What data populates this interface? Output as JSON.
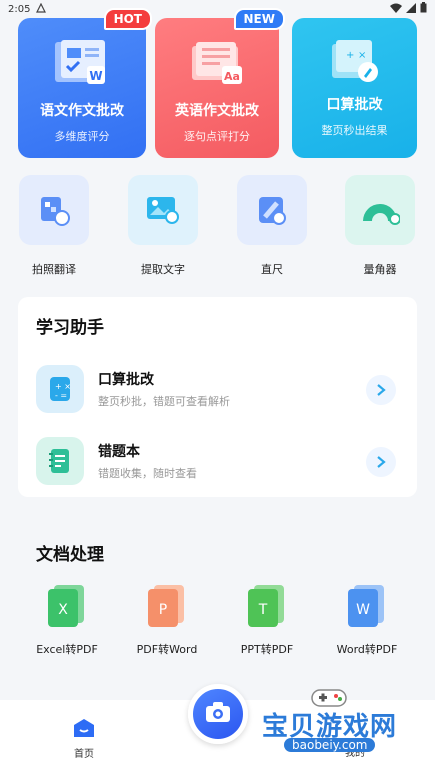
{
  "status_bar": {
    "time": "2:05"
  },
  "feature_cards": [
    {
      "title": "语文作文批改",
      "subtitle": "多维度评分",
      "tag": "HOT",
      "icon": "document-w-icon"
    },
    {
      "title": "英语作文批改",
      "subtitle": "逐句点评打分",
      "tag": "NEW",
      "icon": "newspaper-aa-icon"
    },
    {
      "title": "口算批改",
      "subtitle": "整页秒出结果",
      "tag": "",
      "icon": "calculator-pen-icon"
    }
  ],
  "tools": [
    {
      "label": "拍照翻译",
      "icon": "photo-translate-icon"
    },
    {
      "label": "提取文字",
      "icon": "extract-text-icon"
    },
    {
      "label": "直尺",
      "icon": "ruler-icon"
    },
    {
      "label": "量角器",
      "icon": "protractor-icon"
    }
  ],
  "study": {
    "title": "学习助手",
    "items": [
      {
        "title": "口算批改",
        "subtitle": "整页秒批，错题可查看解析",
        "icon": "calculator-icon"
      },
      {
        "title": "错题本",
        "subtitle": "错题收集，随时查看",
        "icon": "notebook-icon"
      }
    ]
  },
  "docs": {
    "title": "文档处理",
    "items": [
      {
        "label": "Excel转PDF",
        "letter": "X",
        "color": "#3cc26a"
      },
      {
        "label": "PDF转Word",
        "letter": "P",
        "color": "#f5906a"
      },
      {
        "label": "PPT转PDF",
        "letter": "T",
        "color": "#4fc356"
      },
      {
        "label": "Word转PDF",
        "letter": "W",
        "color": "#4c92f0"
      }
    ]
  },
  "nav": {
    "home": "首页",
    "mine": "我的"
  },
  "watermark": {
    "title": "宝贝游戏网",
    "url": "baobeiy.com"
  },
  "colors": {
    "accent": "#3270f3",
    "hot": "#f43d3d",
    "new": "#2f7bf6"
  }
}
